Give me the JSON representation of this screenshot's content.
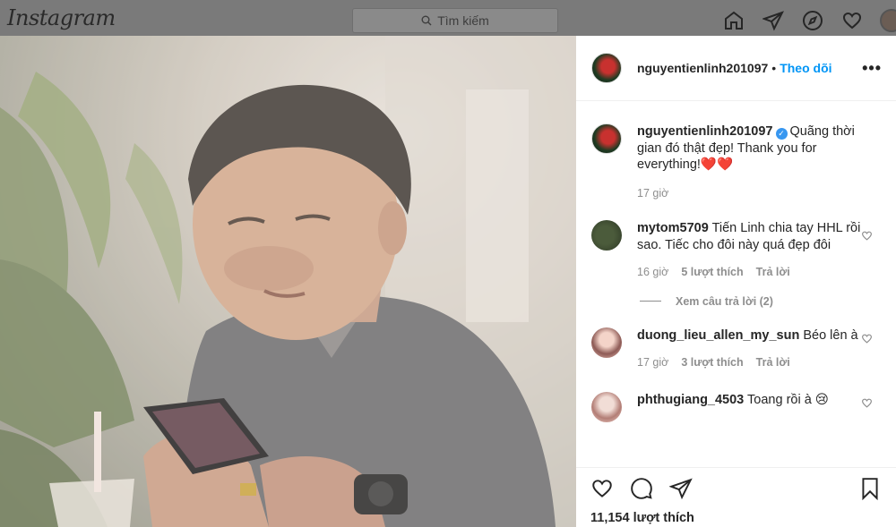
{
  "app": {
    "logo": "Instagram"
  },
  "search": {
    "placeholder": "Tìm kiếm"
  },
  "nav": {
    "icons": [
      "home-icon",
      "direct-icon",
      "explore-icon",
      "activity-icon",
      "profile-avatar"
    ]
  },
  "post": {
    "author": "nguyentienlinh201097",
    "dot": "•",
    "follow_label": "Theo dõi",
    "more": "•••",
    "caption": {
      "username": "nguyentienlinh201097",
      "text": "Quãng thời gian đó thật đẹp! Thank you for everything!❤️❤️",
      "time": "17 giờ"
    },
    "comments": [
      {
        "username": "mytom5709",
        "text": "Tiến Linh chia tay HHL rồi sao. Tiếc cho đôi này quá đẹp đôi",
        "time": "16 giờ",
        "likes": "5 lượt thích",
        "reply": "Trả lời",
        "view_replies": "Xem câu trả lời (2)"
      },
      {
        "username": "duong_lieu_allen_my_sun",
        "text": "Béo lên à",
        "time": "17 giờ",
        "likes": "3 lượt thích",
        "reply": "Trả lời"
      },
      {
        "username": "phthugiang_4503",
        "text": "Toang rồi à 😢"
      }
    ],
    "like_count": "11,154 lượt thích"
  },
  "colors": {
    "link": "#0095f6",
    "muted": "#8e8e8e",
    "text": "#262626",
    "verified": "#3897f0"
  }
}
